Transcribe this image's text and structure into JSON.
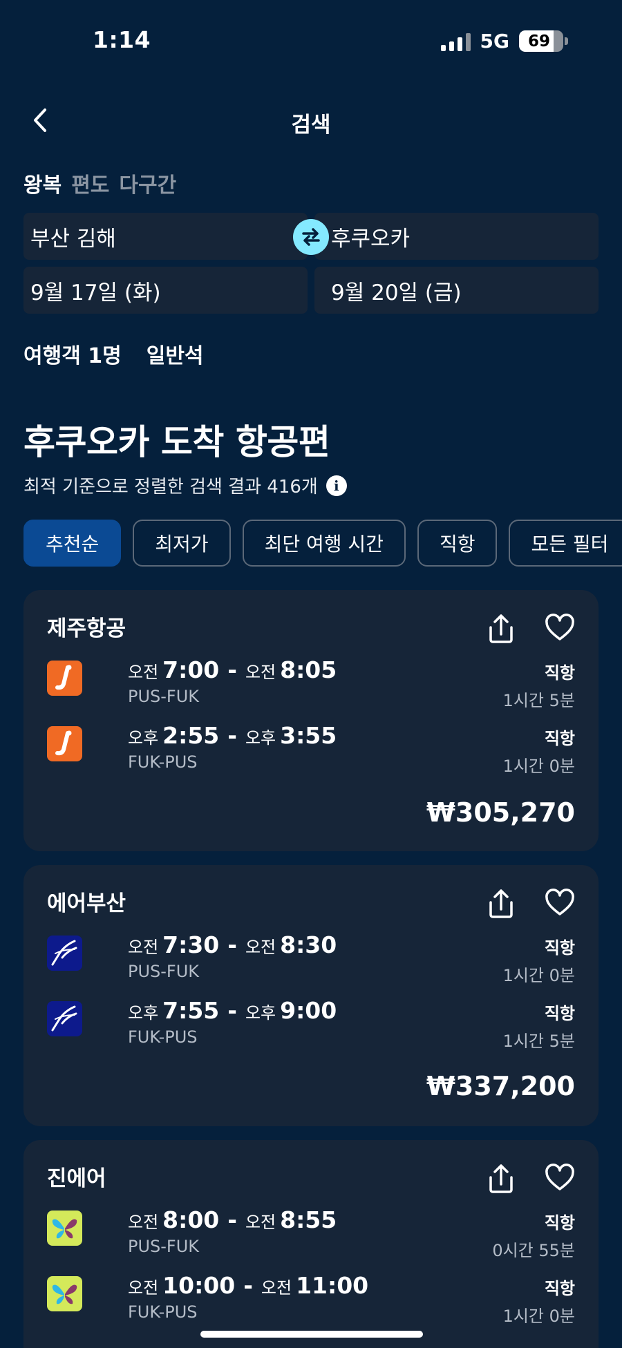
{
  "status_bar": {
    "time": "1:14",
    "network": "5G",
    "battery": "69"
  },
  "header": {
    "title": "검색"
  },
  "trip_types": [
    "왕복",
    "편도",
    "다구간"
  ],
  "search": {
    "origin": "부산 김해",
    "destination": "후쿠오카",
    "depart_date": "9월 17일 (화)",
    "return_date": "9월 20일 (금)"
  },
  "passengers": {
    "travelers": "여행객 1명",
    "cabin": "일반석"
  },
  "results": {
    "title": "후쿠오카 도착 항공편",
    "subtitle": "최적 기준으로 정렬한 검색 결과 416개"
  },
  "filters": [
    "추천순",
    "최저가",
    "최단 여행 시간",
    "직항",
    "모든 필터"
  ],
  "colors": {
    "background": "#05203c",
    "card": "#162538",
    "accent_chip": "#0b4a94",
    "swap": "#84e9ff"
  },
  "flights": [
    {
      "airline": "제주항공",
      "logo": "jejuair-logo",
      "price": "₩305,270",
      "legs": [
        {
          "dep_ampm": "오전",
          "dep": "7:00",
          "arr_ampm": "오전",
          "arr": "8:05",
          "route": "PUS-FUK",
          "stops": "직항",
          "duration": "1시간 5분"
        },
        {
          "dep_ampm": "오후",
          "dep": "2:55",
          "arr_ampm": "오후",
          "arr": "3:55",
          "route": "FUK-PUS",
          "stops": "직항",
          "duration": "1시간 0분"
        }
      ]
    },
    {
      "airline": "에어부산",
      "logo": "airbusan-logo",
      "price": "₩337,200",
      "legs": [
        {
          "dep_ampm": "오전",
          "dep": "7:30",
          "arr_ampm": "오전",
          "arr": "8:30",
          "route": "PUS-FUK",
          "stops": "직항",
          "duration": "1시간 0분"
        },
        {
          "dep_ampm": "오후",
          "dep": "7:55",
          "arr_ampm": "오후",
          "arr": "9:00",
          "route": "FUK-PUS",
          "stops": "직항",
          "duration": "1시간 5분"
        }
      ]
    },
    {
      "airline": "진에어",
      "logo": "jinair-logo",
      "price": "",
      "legs": [
        {
          "dep_ampm": "오전",
          "dep": "8:00",
          "arr_ampm": "오전",
          "arr": "8:55",
          "route": "PUS-FUK",
          "stops": "직항",
          "duration": "0시간 55분"
        },
        {
          "dep_ampm": "오전",
          "dep": "10:00",
          "arr_ampm": "오전",
          "arr": "11:00",
          "route": "FUK-PUS",
          "stops": "직항",
          "duration": "1시간 0분"
        }
      ]
    }
  ]
}
